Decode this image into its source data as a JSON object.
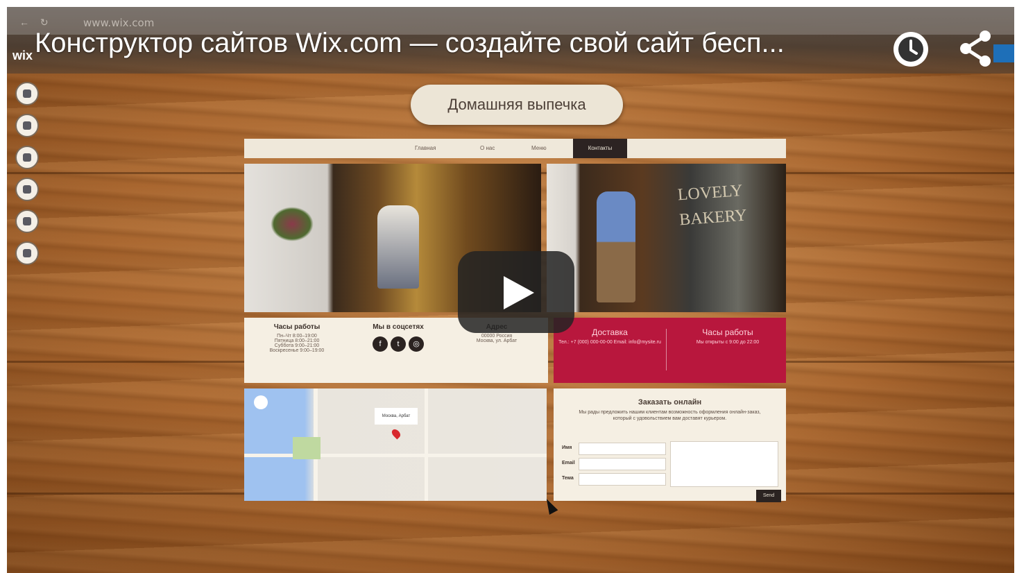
{
  "browser": {
    "url": "www.wix.com",
    "logo": "wix"
  },
  "video": {
    "title": "Конструктор сайтов Wix.com — создайте свой сайт бесп...",
    "watch_later_icon": "clock-icon",
    "share_icon": "share-icon",
    "play_icon": "play-icon"
  },
  "side_tools": [
    "pages-icon",
    "settings-icon",
    "app-icon",
    "upload-icon",
    "media-icon",
    "store-icon"
  ],
  "site": {
    "badge_title": "Домашняя выпечка",
    "nav": [
      "Главная",
      "О нас",
      "Меню",
      "Контакты"
    ],
    "photo_sign": "LOVELY BAKERY",
    "info": [
      {
        "head": "Часы работы",
        "lines": [
          "Пн–Чт 8:00–19:00",
          "Пятница 8:00–21:00",
          "Суббота 9:00–21:00",
          "Воскресенье 9:00–19:00"
        ]
      },
      {
        "head": "Мы в соцсетях",
        "lines": []
      },
      {
        "head": "Адрес",
        "lines": [
          "00000 Россия",
          "Москва, ул. Арбат"
        ]
      }
    ],
    "delivery": {
      "head": "Доставка",
      "line": "Тел.: +7 (000) 000-00-00 Email: info@mysite.ru"
    },
    "hours2": {
      "head": "Часы работы",
      "line": "Мы открыты с 9:00 до 22:00"
    },
    "form": {
      "title": "Заказать онлайн",
      "desc": "Мы рады предложить нашим клиентам возможность оформления онлайн-заказ, который с удовольствием вам доставят курьером.",
      "name_label": "Имя",
      "email_label": "Email",
      "phone_label": "Тема",
      "send_label": "Send"
    },
    "map_label": "Москва, Арбат"
  },
  "colors": {
    "wood": "#a8652e",
    "accent_red": "#b8173d",
    "dark": "#2b2321"
  }
}
